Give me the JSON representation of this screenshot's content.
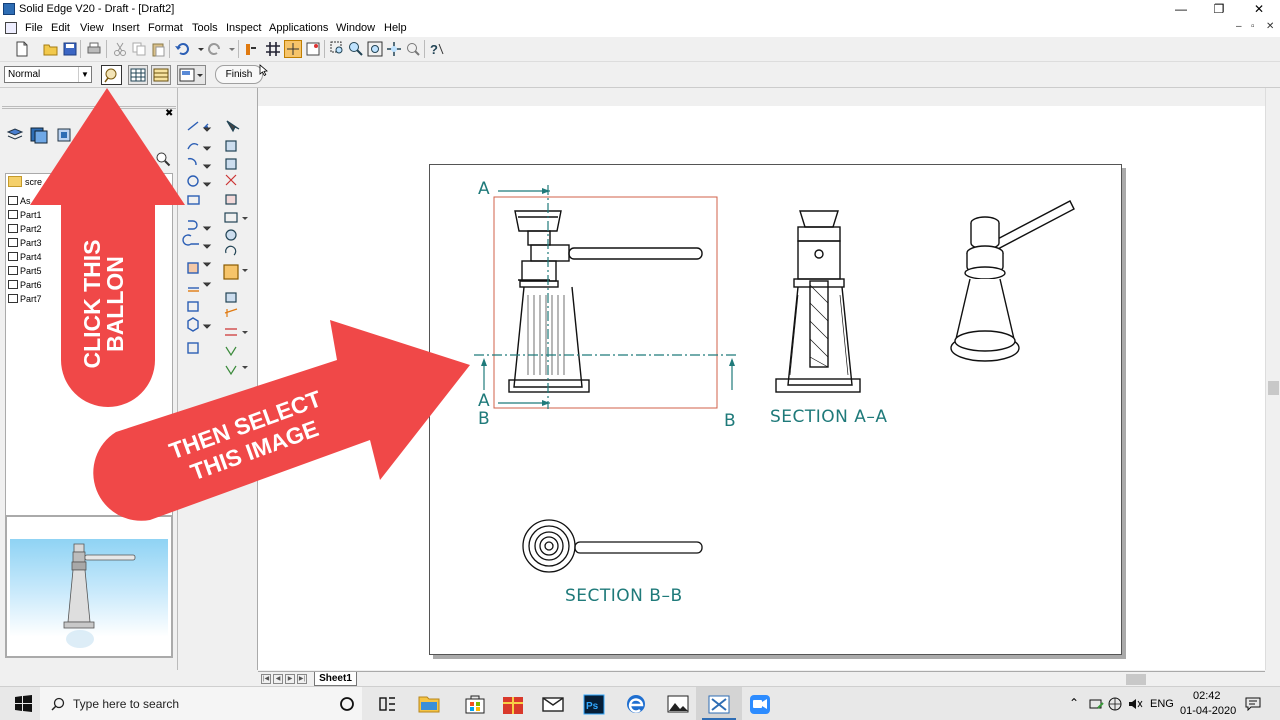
{
  "window": {
    "title": "Solid Edge V20 - Draft - [Draft2]",
    "minimize": "—",
    "maximize": "❐",
    "close": "✕"
  },
  "menu": [
    "File",
    "Edit",
    "View",
    "Insert",
    "Format",
    "Tools",
    "Inspect",
    "Applications",
    "Window",
    "Help"
  ],
  "mdi_controls": [
    "–",
    "▫",
    "✕"
  ],
  "ribbon": {
    "style_value": "Normal",
    "finish_label": "Finish"
  },
  "sidebar": {
    "folder_label": "scre",
    "tree_items": [
      "As",
      "Part1",
      "Part2",
      "Part3",
      "Part4",
      "Part5",
      "Part6",
      "Part7"
    ]
  },
  "drawing": {
    "label_A_top": "A",
    "label_A_bottom": "A",
    "label_B_left": "B",
    "label_B_right": "B",
    "section_aa": "SECTION A–A",
    "section_bb": "SECTION B–B"
  },
  "tabs": {
    "sheet1": "Sheet1"
  },
  "overlays": {
    "arrow_up_line1": "CLICK THIS",
    "arrow_up_line2": "BALLON",
    "arrow_right_line1": "THEN SELECT",
    "arrow_right_line2": "THIS IMAGE",
    "color": "#f04848"
  },
  "taskbar": {
    "search_placeholder": "Type here to search",
    "language": "ENG",
    "time": "02:42",
    "date": "01-04-2020"
  }
}
